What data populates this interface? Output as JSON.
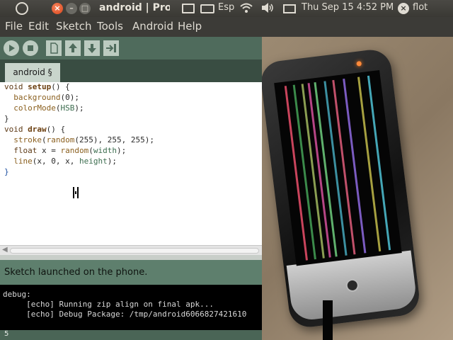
{
  "top_panel": {
    "window_title": "android | Processing",
    "keyboard_layout": "Esp",
    "clock": "Thu Sep 15  4:52 PM",
    "user": "flot",
    "close_glyph": "×",
    "minimize_glyph": "–",
    "maximize_glyph": "□",
    "session_glyph": "×",
    "icons": [
      "ubuntu-logo-icon",
      "monitor-icon",
      "keyboard-icon",
      "wifi-icon",
      "volume-icon",
      "mail-icon",
      "session-icon"
    ]
  },
  "menu": {
    "items": [
      "File",
      "Edit",
      "Sketch",
      "Tools",
      "Android",
      "Help"
    ]
  },
  "toolbar": {
    "buttons": [
      "run-icon",
      "stop-icon",
      "new-icon",
      "open-icon",
      "save-icon",
      "export-icon"
    ]
  },
  "tabs": [
    {
      "label": "android §"
    }
  ],
  "editor": {
    "lines": [
      [
        "void ",
        "setup",
        "() {"
      ],
      [
        "  ",
        "background",
        "(0);"
      ],
      [
        "  ",
        "colorMode",
        "(",
        "HSB",
        ");"
      ],
      [
        "}"
      ],
      [
        "void ",
        "draw",
        "() {"
      ],
      [
        "  ",
        "stroke",
        "(",
        "random",
        "(255), 255, 255);"
      ],
      [
        "  ",
        "float",
        " x = ",
        "random",
        "(",
        "width",
        ");"
      ],
      [
        "  ",
        "line",
        "(x, 0, x, ",
        "height",
        ");"
      ],
      [
        "}"
      ]
    ]
  },
  "status": {
    "message": "Sketch launched on the phone."
  },
  "console": {
    "lines": [
      "debug:",
      "     [echo] Running zip align on final apk...",
      "     [echo] Debug Package: /tmp/android6066827421610"
    ]
  },
  "line_number": "5",
  "colors": {
    "accent_toolbar": "#4f6b5c",
    "status_bg": "#5e7f6d",
    "panel_bg": "#3c3b37"
  },
  "phone_stripes": [
    "#c9445c",
    "#3b8a4a",
    "#8a9e52",
    "#b64585",
    "#5fb06c",
    "#3c8fa0",
    "#c0506a",
    "#7a5bc0",
    "#a6a040",
    "#44a6b6"
  ]
}
